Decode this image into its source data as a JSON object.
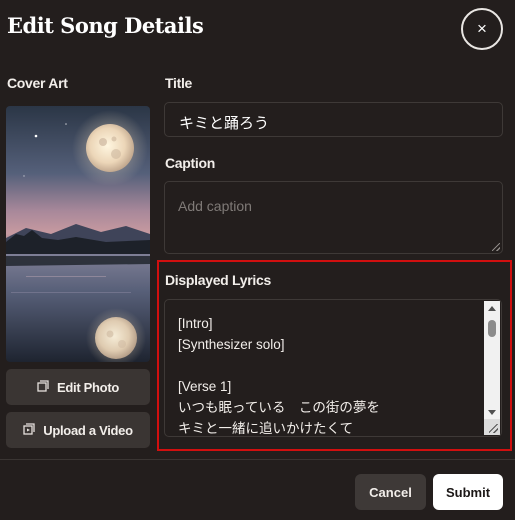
{
  "dialog": {
    "title": "Edit Song Details",
    "close_icon": "×"
  },
  "cover_art": {
    "label": "Cover Art",
    "image": "moonlit lake at dusk with reflected full moon",
    "edit_photo": {
      "icon": "image-icon",
      "label": "Edit Photo"
    },
    "upload_video": {
      "icon": "video-icon",
      "label": "Upload a Video"
    }
  },
  "fields": {
    "title_label": "Title",
    "title_value": "キミと踊ろう",
    "caption_label": "Caption",
    "caption_placeholder": "Add caption",
    "lyrics_label": "Displayed Lyrics",
    "lyrics_lines": [
      "[Intro]",
      "[Synthesizer solo]",
      "",
      "[Verse 1]",
      "いつも眠っている　この街の夢を",
      "キミと一緒に追いかけたくて"
    ]
  },
  "footer": {
    "cancel_label": "Cancel",
    "submit_label": "Submit"
  },
  "colors": {
    "background": "#231e1d",
    "highlight": "#d10f0f",
    "submit_bg": "#ffffff"
  }
}
